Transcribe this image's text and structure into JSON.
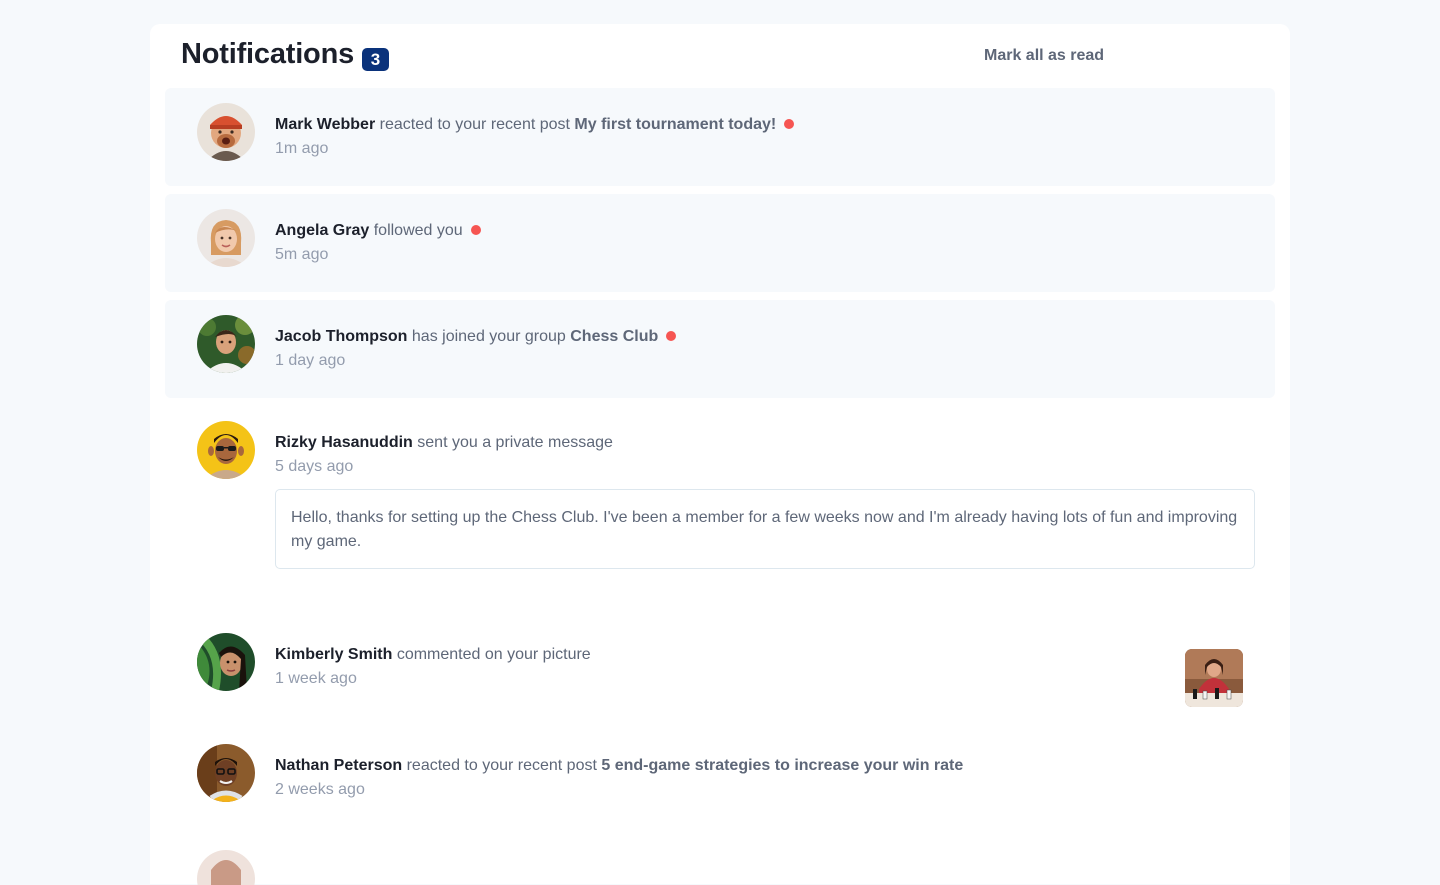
{
  "header": {
    "title": "Notifications",
    "unread_count": "3",
    "mark_all_label": "Mark all as read"
  },
  "notifications": [
    {
      "name": "Mark Webber",
      "action": "reacted to your recent post",
      "target": "My first tournament today!",
      "time": "1m ago",
      "unread": true,
      "avatar": "avatar-mark-webber"
    },
    {
      "name": "Angela Gray",
      "action": "followed you",
      "target": "",
      "time": "5m ago",
      "unread": true,
      "avatar": "avatar-angela-gray"
    },
    {
      "name": "Jacob Thompson",
      "action": "has joined your group",
      "target": "Chess Club",
      "time": "1 day ago",
      "unread": true,
      "avatar": "avatar-jacob-thompson"
    },
    {
      "name": "Rizky Hasanuddin",
      "action": "sent you a private message",
      "target": "",
      "time": "5 days ago",
      "unread": false,
      "avatar": "avatar-rizky-hasanuddin",
      "message": "Hello, thanks for setting up the Chess Club. I've been a member for a few weeks now and I'm already having lots of fun and improving my game."
    },
    {
      "name": "Kimberly Smith",
      "action": "commented on your picture",
      "target": "",
      "time": "1 week ago",
      "unread": false,
      "avatar": "avatar-kimberly-smith",
      "thumbnail": "chess-picture-thumbnail"
    },
    {
      "name": "Nathan Peterson",
      "action": "reacted to your recent post",
      "target": "5 end-game strategies to increase your win rate",
      "time": "2 weeks ago",
      "unread": false,
      "avatar": "avatar-nathan-peterson"
    }
  ],
  "colors": {
    "unread_dot": "#f65552",
    "badge": "#0a327b",
    "unread_bg": "#f6f9fc"
  }
}
